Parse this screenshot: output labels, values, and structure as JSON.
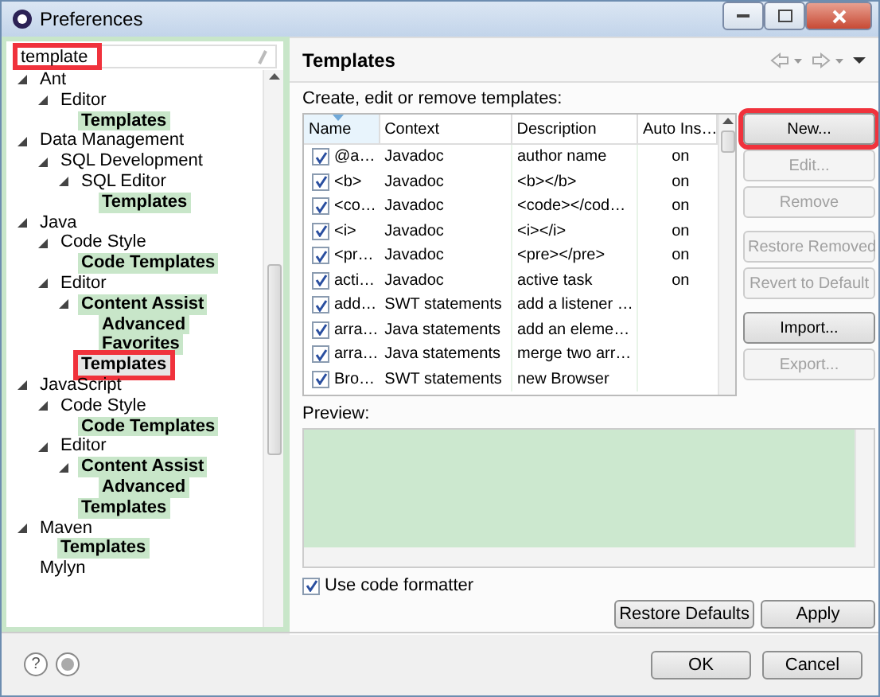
{
  "window": {
    "title": "Preferences"
  },
  "filter": {
    "value": "template",
    "marked": true
  },
  "tree": [
    {
      "label": "Ant",
      "match": false,
      "selected": false,
      "children": [
        {
          "label": "Editor",
          "match": false,
          "selected": false,
          "children": [
            {
              "label": "Templates",
              "match": true,
              "selected": false
            }
          ]
        }
      ]
    },
    {
      "label": "Data Management",
      "match": false,
      "selected": false,
      "children": [
        {
          "label": "SQL Development",
          "match": false,
          "selected": false,
          "children": [
            {
              "label": "SQL Editor",
              "match": false,
              "selected": false,
              "children": [
                {
                  "label": "Templates",
                  "match": true,
                  "selected": false
                }
              ]
            }
          ]
        }
      ]
    },
    {
      "label": "Java",
      "match": false,
      "selected": false,
      "children": [
        {
          "label": "Code Style",
          "match": false,
          "selected": false,
          "children": [
            {
              "label": "Code Templates",
              "match": true,
              "selected": false
            }
          ]
        },
        {
          "label": "Editor",
          "match": false,
          "selected": false,
          "children": [
            {
              "label": "Content Assist",
              "match": true,
              "selected": false,
              "children": [
                {
                  "label": "Advanced",
                  "match": true,
                  "selected": false
                },
                {
                  "label": "Favorites",
                  "match": true,
                  "selected": false
                }
              ]
            },
            {
              "label": "Templates",
              "match": true,
              "selected": true
            }
          ]
        }
      ]
    },
    {
      "label": "JavaScript",
      "match": false,
      "selected": false,
      "children": [
        {
          "label": "Code Style",
          "match": false,
          "selected": false,
          "children": [
            {
              "label": "Code Templates",
              "match": true,
              "selected": false
            }
          ]
        },
        {
          "label": "Editor",
          "match": false,
          "selected": false,
          "children": [
            {
              "label": "Content Assist",
              "match": true,
              "selected": false,
              "children": [
                {
                  "label": "Advanced",
                  "match": true,
                  "selected": false
                }
              ]
            },
            {
              "label": "Templates",
              "match": true,
              "selected": false
            }
          ]
        }
      ]
    },
    {
      "label": "Maven",
      "match": false,
      "selected": false,
      "children": [
        {
          "label": "Templates",
          "match": true,
          "selected": false
        }
      ]
    },
    {
      "label": "Mylyn",
      "match": false,
      "selected": false
    }
  ],
  "page": {
    "title": "Templates",
    "description": "Create, edit or remove templates:"
  },
  "table": {
    "columns": [
      {
        "label": "Name",
        "sorted": true
      },
      {
        "label": "Context",
        "sorted": false
      },
      {
        "label": "Description",
        "sorted": false
      },
      {
        "label": "Auto Ins…",
        "sorted": false
      }
    ],
    "rows": [
      {
        "checked": true,
        "name": "@a…",
        "context": "Javadoc",
        "description": "author name",
        "auto_insert": "on"
      },
      {
        "checked": true,
        "name": "<b>",
        "context": "Javadoc",
        "description": "<b></b>",
        "auto_insert": "on"
      },
      {
        "checked": true,
        "name": "<co…",
        "context": "Javadoc",
        "description": "<code></cod…",
        "auto_insert": "on"
      },
      {
        "checked": true,
        "name": "<i>",
        "context": "Javadoc",
        "description": "<i></i>",
        "auto_insert": "on"
      },
      {
        "checked": true,
        "name": "<pr…",
        "context": "Javadoc",
        "description": "<pre></pre>",
        "auto_insert": "on"
      },
      {
        "checked": true,
        "name": "acti…",
        "context": "Javadoc",
        "description": "active task",
        "auto_insert": "on"
      },
      {
        "checked": true,
        "name": "add…",
        "context": "SWT statements",
        "description": "add a listener …"
      },
      {
        "checked": true,
        "name": "arra…",
        "context": "Java statements",
        "description": "add an eleme…"
      },
      {
        "checked": true,
        "name": "arra…",
        "context": "Java statements",
        "description": "merge two arr…"
      },
      {
        "checked": true,
        "name": "Bro…",
        "context": "SWT statements",
        "description": "new Browser"
      }
    ]
  },
  "button_groups": [
    [
      {
        "label": "New...",
        "disabled": false,
        "marked": true
      },
      {
        "label": "Edit...",
        "disabled": true,
        "marked": false
      },
      {
        "label": "Remove",
        "disabled": true,
        "marked": false
      }
    ],
    [
      {
        "label": "Restore Removed",
        "disabled": true,
        "marked": false
      },
      {
        "label": "Revert to Default",
        "disabled": true,
        "marked": false
      }
    ],
    [
      {
        "label": "Import...",
        "disabled": false,
        "marked": false
      },
      {
        "label": "Export...",
        "disabled": true,
        "marked": false
      }
    ]
  ],
  "preview": {
    "label": "Preview:"
  },
  "formatter": {
    "label": "Use code formatter",
    "checked": true
  },
  "page_buttons": [
    "Restore Defaults",
    "Apply"
  ],
  "dialog_buttons": [
    "OK",
    "Cancel"
  ],
  "help": {
    "glyph": "?"
  }
}
